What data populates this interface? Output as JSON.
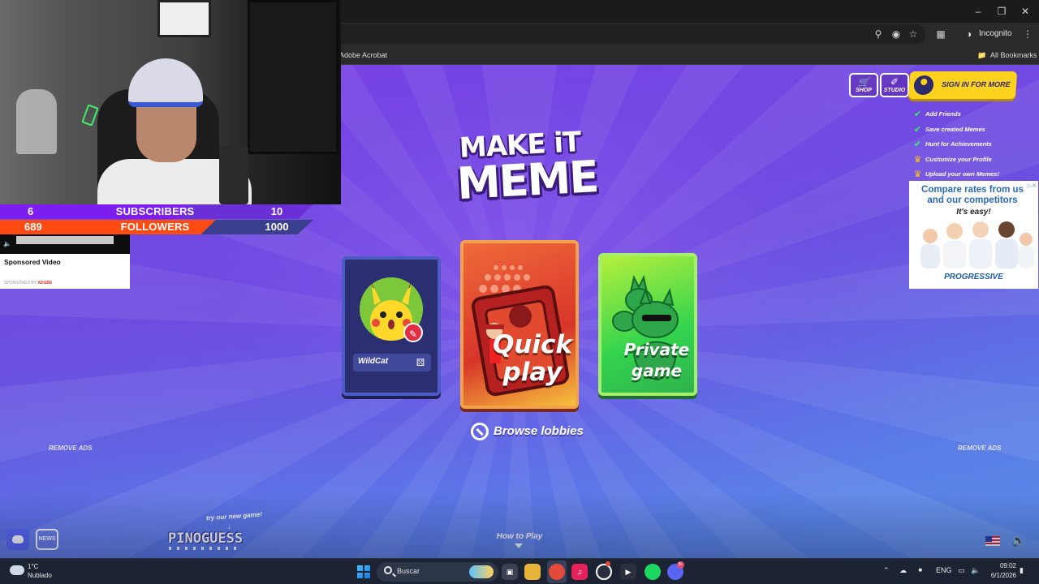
{
  "browser": {
    "incognito_label": "Incognito",
    "bookmark_adobe": "Adobe Acrobat",
    "bookmark_all": "All Bookmarks"
  },
  "game": {
    "logo_line1": "MAKE iT",
    "logo_line2": "MEME",
    "profile_name": "WildCat",
    "quick_play_label": "Quick play",
    "private_game_label": "Private game",
    "browse_lobbies": "Browse lobbies",
    "remove_ads_left": "REMOVE ADS",
    "remove_ads_right": "REMOVE ADS",
    "how_to_play": "How to Play",
    "shop_label": "SHOP",
    "studio_label": "STUDIO",
    "sign_in_label": "SIGN IN FOR MORE",
    "perks": [
      {
        "label": "Add Friends",
        "icon": "check-icon",
        "color": "#3cf06a"
      },
      {
        "label": "Save created Memes",
        "icon": "check-icon",
        "color": "#3cf06a"
      },
      {
        "label": "Hunt for Achievements",
        "icon": "check-icon",
        "color": "#3cf06a"
      },
      {
        "label": "Customize your Profile",
        "icon": "crown-icon",
        "color": "#ffc21f"
      },
      {
        "label": "Upload your own Memes!",
        "icon": "crown-icon",
        "color": "#ffc21f"
      }
    ],
    "news_label": "NEWS",
    "try_new_game": "try our new game!",
    "pinoguess": "PINOGUESS"
  },
  "ad_right": {
    "headline": "Compare rates from us and our competitors",
    "sub": "It's easy!",
    "brand": "PROGRESSIVE"
  },
  "overlay": {
    "subscribers_current": "6",
    "subscribers_label": "SUBSCRIBERS",
    "subscribers_goal": "10",
    "subscribers_progress": 0.6,
    "followers_current": "689",
    "followers_label": "FOLLOWERS",
    "followers_goal": "1000",
    "followers_progress": 0.689,
    "ad_title": "Sponsored Video",
    "ad_sponsor_prefix": "SPONSORED BY",
    "ad_sponsor": "ADOBE"
  },
  "taskbar": {
    "temp": "1°C",
    "weather": "Nublado",
    "search_placeholder": "Buscar",
    "lang": "ENG",
    "time": "09:02",
    "date": "6/1/2026",
    "discord_badge": "9+"
  },
  "colors": {
    "accent_yellow": "#ffd21f",
    "sub_bar": "#7c1ef0",
    "follower_bar": "#ff4b12"
  }
}
